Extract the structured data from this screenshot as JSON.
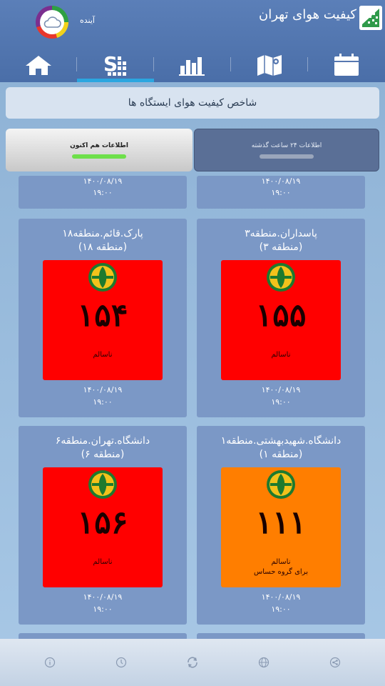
{
  "header": {
    "app_title": "کیفیت هوای تهران",
    "forecast_label": "آینده"
  },
  "nav": {
    "items": [
      {
        "icon": "home-icon"
      },
      {
        "icon": "stations-icon"
      },
      {
        "icon": "bar-chart-icon"
      },
      {
        "icon": "map-icon"
      },
      {
        "icon": "calendar-icon"
      }
    ],
    "active_index": 1
  },
  "main": {
    "section_title": "شاخص کیفیت هوای ایستگاه ها",
    "tabs": {
      "now_label": "اطلاعات هم اکنون",
      "last24_label": "اطلاعات ۲۴ ساعت گذشته"
    },
    "partial_cards": [
      {
        "date": "۱۴۰۰/۰۸/۱۹",
        "time": "۱۹:۰۰"
      },
      {
        "date": "۱۴۰۰/۰۸/۱۹",
        "time": "۱۹:۰۰"
      }
    ],
    "cards": [
      {
        "name": "پارک.قائم.منطقه۱۸",
        "district": "(منطقه ۱۸)",
        "aqi": "۱۵۴",
        "status": "ناسالم",
        "date": "۱۴۰۰/۰۸/۱۹",
        "time": "۱۹:۰۰"
      },
      {
        "name": "پاسداران.منطقه۳",
        "district": "(منطقه ۳)",
        "aqi": "۱۵۵",
        "status": "ناسالم",
        "date": "۱۴۰۰/۰۸/۱۹",
        "time": "۱۹:۰۰"
      },
      {
        "name": "دانشگاه.تهران.منطقه۶",
        "district": "(منطقه ۶)",
        "aqi": "۱۵۶",
        "status": "ناسالم",
        "date": "۱۴۰۰/۰۸/۱۹",
        "time": "۱۹:۰۰"
      },
      {
        "name": "دانشگاه.شهیدبهشتی.منطقه۱",
        "district": "(منطقه ۱)",
        "aqi": "۱۱۱",
        "status": "ناسالم",
        "status2": "برای گروه حساس",
        "date": "۱۴۰۰/۰۸/۱۹",
        "time": "۱۹:۰۰"
      }
    ]
  },
  "colors": {
    "unhealthy": "#ff0000",
    "unhealthy_sensitive": "#ff7e00",
    "active_tab_indicator": "#2ba6e0"
  },
  "footer": {
    "icons": [
      "info-icon",
      "clock-icon",
      "refresh-icon",
      "globe-icon",
      "share-icon"
    ]
  }
}
